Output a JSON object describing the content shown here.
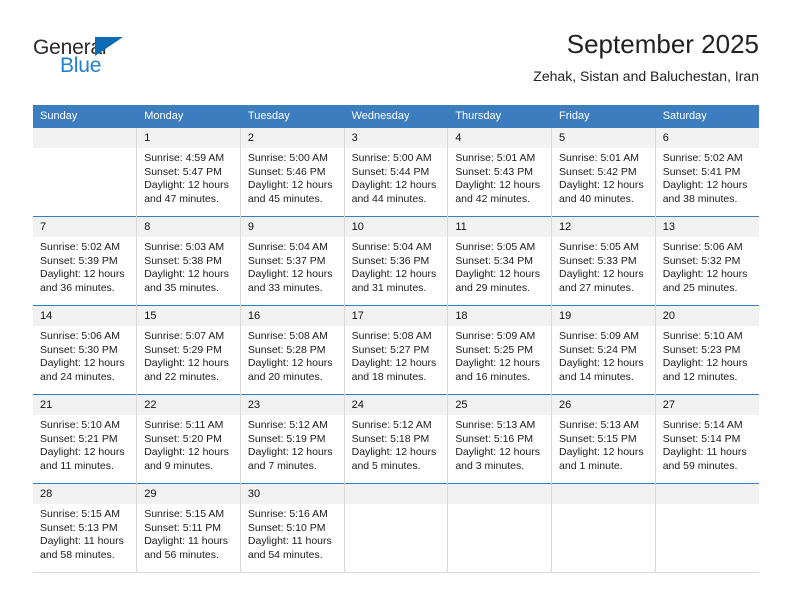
{
  "brand": {
    "name_top": "General",
    "name_bottom": "Blue",
    "accent_color": "#1f7fd0",
    "triangle_color": "#0d6ab5"
  },
  "header": {
    "title": "September 2025",
    "subtitle": "Zehak, Sistan and Baluchestan, Iran"
  },
  "theme": {
    "header_bg": "#3b7dbf",
    "daynum_bg": "#f2f2f2",
    "grid_line": "#d9d9d9"
  },
  "weekdays": [
    "Sunday",
    "Monday",
    "Tuesday",
    "Wednesday",
    "Thursday",
    "Friday",
    "Saturday"
  ],
  "weeks": [
    [
      {
        "day": "",
        "sunrise": "",
        "sunset": "",
        "daylight1": "",
        "daylight2": ""
      },
      {
        "day": "1",
        "sunrise": "Sunrise: 4:59 AM",
        "sunset": "Sunset: 5:47 PM",
        "daylight1": "Daylight: 12 hours",
        "daylight2": "and 47 minutes."
      },
      {
        "day": "2",
        "sunrise": "Sunrise: 5:00 AM",
        "sunset": "Sunset: 5:46 PM",
        "daylight1": "Daylight: 12 hours",
        "daylight2": "and 45 minutes."
      },
      {
        "day": "3",
        "sunrise": "Sunrise: 5:00 AM",
        "sunset": "Sunset: 5:44 PM",
        "daylight1": "Daylight: 12 hours",
        "daylight2": "and 44 minutes."
      },
      {
        "day": "4",
        "sunrise": "Sunrise: 5:01 AM",
        "sunset": "Sunset: 5:43 PM",
        "daylight1": "Daylight: 12 hours",
        "daylight2": "and 42 minutes."
      },
      {
        "day": "5",
        "sunrise": "Sunrise: 5:01 AM",
        "sunset": "Sunset: 5:42 PM",
        "daylight1": "Daylight: 12 hours",
        "daylight2": "and 40 minutes."
      },
      {
        "day": "6",
        "sunrise": "Sunrise: 5:02 AM",
        "sunset": "Sunset: 5:41 PM",
        "daylight1": "Daylight: 12 hours",
        "daylight2": "and 38 minutes."
      }
    ],
    [
      {
        "day": "7",
        "sunrise": "Sunrise: 5:02 AM",
        "sunset": "Sunset: 5:39 PM",
        "daylight1": "Daylight: 12 hours",
        "daylight2": "and 36 minutes."
      },
      {
        "day": "8",
        "sunrise": "Sunrise: 5:03 AM",
        "sunset": "Sunset: 5:38 PM",
        "daylight1": "Daylight: 12 hours",
        "daylight2": "and 35 minutes."
      },
      {
        "day": "9",
        "sunrise": "Sunrise: 5:04 AM",
        "sunset": "Sunset: 5:37 PM",
        "daylight1": "Daylight: 12 hours",
        "daylight2": "and 33 minutes."
      },
      {
        "day": "10",
        "sunrise": "Sunrise: 5:04 AM",
        "sunset": "Sunset: 5:36 PM",
        "daylight1": "Daylight: 12 hours",
        "daylight2": "and 31 minutes."
      },
      {
        "day": "11",
        "sunrise": "Sunrise: 5:05 AM",
        "sunset": "Sunset: 5:34 PM",
        "daylight1": "Daylight: 12 hours",
        "daylight2": "and 29 minutes."
      },
      {
        "day": "12",
        "sunrise": "Sunrise: 5:05 AM",
        "sunset": "Sunset: 5:33 PM",
        "daylight1": "Daylight: 12 hours",
        "daylight2": "and 27 minutes."
      },
      {
        "day": "13",
        "sunrise": "Sunrise: 5:06 AM",
        "sunset": "Sunset: 5:32 PM",
        "daylight1": "Daylight: 12 hours",
        "daylight2": "and 25 minutes."
      }
    ],
    [
      {
        "day": "14",
        "sunrise": "Sunrise: 5:06 AM",
        "sunset": "Sunset: 5:30 PM",
        "daylight1": "Daylight: 12 hours",
        "daylight2": "and 24 minutes."
      },
      {
        "day": "15",
        "sunrise": "Sunrise: 5:07 AM",
        "sunset": "Sunset: 5:29 PM",
        "daylight1": "Daylight: 12 hours",
        "daylight2": "and 22 minutes."
      },
      {
        "day": "16",
        "sunrise": "Sunrise: 5:08 AM",
        "sunset": "Sunset: 5:28 PM",
        "daylight1": "Daylight: 12 hours",
        "daylight2": "and 20 minutes."
      },
      {
        "day": "17",
        "sunrise": "Sunrise: 5:08 AM",
        "sunset": "Sunset: 5:27 PM",
        "daylight1": "Daylight: 12 hours",
        "daylight2": "and 18 minutes."
      },
      {
        "day": "18",
        "sunrise": "Sunrise: 5:09 AM",
        "sunset": "Sunset: 5:25 PM",
        "daylight1": "Daylight: 12 hours",
        "daylight2": "and 16 minutes."
      },
      {
        "day": "19",
        "sunrise": "Sunrise: 5:09 AM",
        "sunset": "Sunset: 5:24 PM",
        "daylight1": "Daylight: 12 hours",
        "daylight2": "and 14 minutes."
      },
      {
        "day": "20",
        "sunrise": "Sunrise: 5:10 AM",
        "sunset": "Sunset: 5:23 PM",
        "daylight1": "Daylight: 12 hours",
        "daylight2": "and 12 minutes."
      }
    ],
    [
      {
        "day": "21",
        "sunrise": "Sunrise: 5:10 AM",
        "sunset": "Sunset: 5:21 PM",
        "daylight1": "Daylight: 12 hours",
        "daylight2": "and 11 minutes."
      },
      {
        "day": "22",
        "sunrise": "Sunrise: 5:11 AM",
        "sunset": "Sunset: 5:20 PM",
        "daylight1": "Daylight: 12 hours",
        "daylight2": "and 9 minutes."
      },
      {
        "day": "23",
        "sunrise": "Sunrise: 5:12 AM",
        "sunset": "Sunset: 5:19 PM",
        "daylight1": "Daylight: 12 hours",
        "daylight2": "and 7 minutes."
      },
      {
        "day": "24",
        "sunrise": "Sunrise: 5:12 AM",
        "sunset": "Sunset: 5:18 PM",
        "daylight1": "Daylight: 12 hours",
        "daylight2": "and 5 minutes."
      },
      {
        "day": "25",
        "sunrise": "Sunrise: 5:13 AM",
        "sunset": "Sunset: 5:16 PM",
        "daylight1": "Daylight: 12 hours",
        "daylight2": "and 3 minutes."
      },
      {
        "day": "26",
        "sunrise": "Sunrise: 5:13 AM",
        "sunset": "Sunset: 5:15 PM",
        "daylight1": "Daylight: 12 hours",
        "daylight2": "and 1 minute."
      },
      {
        "day": "27",
        "sunrise": "Sunrise: 5:14 AM",
        "sunset": "Sunset: 5:14 PM",
        "daylight1": "Daylight: 11 hours",
        "daylight2": "and 59 minutes."
      }
    ],
    [
      {
        "day": "28",
        "sunrise": "Sunrise: 5:15 AM",
        "sunset": "Sunset: 5:13 PM",
        "daylight1": "Daylight: 11 hours",
        "daylight2": "and 58 minutes."
      },
      {
        "day": "29",
        "sunrise": "Sunrise: 5:15 AM",
        "sunset": "Sunset: 5:11 PM",
        "daylight1": "Daylight: 11 hours",
        "daylight2": "and 56 minutes."
      },
      {
        "day": "30",
        "sunrise": "Sunrise: 5:16 AM",
        "sunset": "Sunset: 5:10 PM",
        "daylight1": "Daylight: 11 hours",
        "daylight2": "and 54 minutes."
      },
      {
        "day": "",
        "sunrise": "",
        "sunset": "",
        "daylight1": "",
        "daylight2": ""
      },
      {
        "day": "",
        "sunrise": "",
        "sunset": "",
        "daylight1": "",
        "daylight2": ""
      },
      {
        "day": "",
        "sunrise": "",
        "sunset": "",
        "daylight1": "",
        "daylight2": ""
      },
      {
        "day": "",
        "sunrise": "",
        "sunset": "",
        "daylight1": "",
        "daylight2": ""
      }
    ]
  ]
}
